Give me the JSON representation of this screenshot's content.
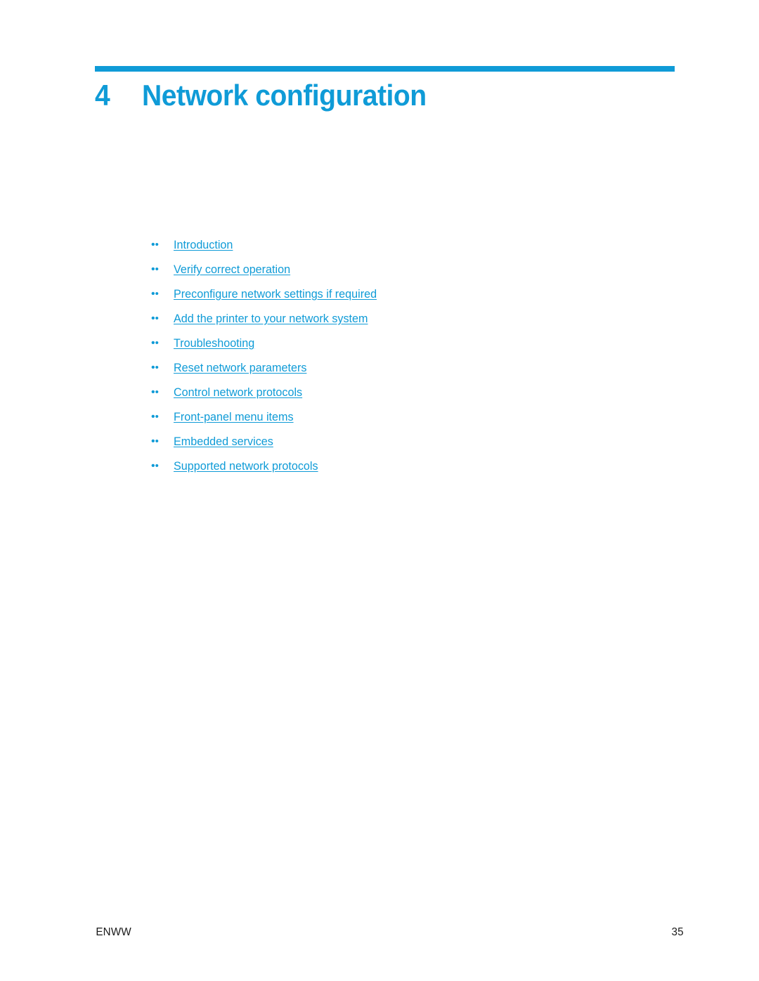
{
  "page": {
    "background_color": "#ffffff",
    "accent_color": "#0f9bd7",
    "text_color": "#1a1a1a"
  },
  "chapter": {
    "number": "4",
    "title": "Network configuration"
  },
  "toc": {
    "bullet_glyph": "•",
    "items": [
      {
        "label": "Introduction"
      },
      {
        "label": "Verify correct operation"
      },
      {
        "label": "Preconfigure network settings if required"
      },
      {
        "label": "Add the printer to your network system"
      },
      {
        "label": "Troubleshooting"
      },
      {
        "label": "Reset network parameters"
      },
      {
        "label": "Control network protocols"
      },
      {
        "label": "Front-panel menu items"
      },
      {
        "label": "Embedded services"
      },
      {
        "label": "Supported network protocols"
      }
    ]
  },
  "footer": {
    "locale_code": "ENWW",
    "page_number": "35"
  }
}
